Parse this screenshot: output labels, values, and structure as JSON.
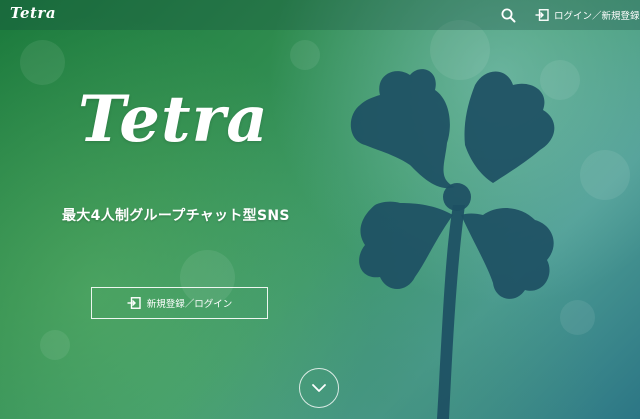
{
  "header": {
    "logo": "Tetra",
    "search_icon": "search-icon",
    "login_icon": "login-icon",
    "login_label": "ログイン／新規登録"
  },
  "hero": {
    "logo": "Tetra",
    "tagline": "最大4人制グループチャット型SNS",
    "cta_icon": "login-icon",
    "cta_label": "新規登録／ログイン",
    "scroll_icon": "chevron-down-icon"
  },
  "colors": {
    "primary_green": "#2e8b4e",
    "teal": "#4d9d93",
    "clover_silhouette": "#1d4f63",
    "text": "#ffffff"
  }
}
